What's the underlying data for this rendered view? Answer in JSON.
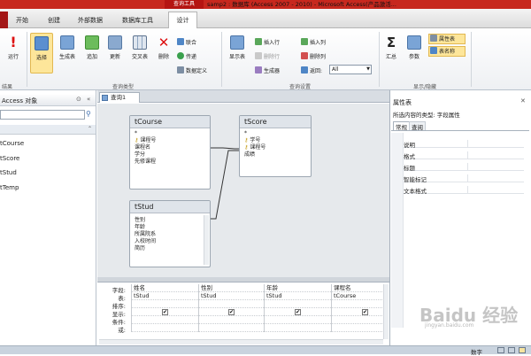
{
  "title_bar": {
    "context_tool": "查询工具",
    "window_title": "samp2 : 数据库 (Access 2007 - 2010) - Microsoft Access(产品激活..."
  },
  "tabs": [
    "开始",
    "创建",
    "外部数据",
    "数据库工具",
    "设计"
  ],
  "ribbon": {
    "run": "运行",
    "select": "选择",
    "make_table": "生成表",
    "append": "追加",
    "update": "更新",
    "crosstab": "交叉表",
    "delete": "删除",
    "union": "联合",
    "passthrough": "传递",
    "data_definition": "数据定义",
    "show_table": "显示表",
    "insert_row": "插入行",
    "delete_row": "删除行",
    "builder": "生成器",
    "insert_col": "插入列",
    "delete_col": "删除列",
    "return_label": "返回:",
    "return_value": "All",
    "totals": "汇总",
    "parameters": "参数",
    "property_sheet": "属性表",
    "table_names": "表名称",
    "group_results": "结果",
    "group_query_type": "查询类型",
    "group_query_setup": "查询设置",
    "group_show_hide": "显示/隐藏"
  },
  "nav": {
    "title": "Access 对象",
    "items": [
      "tCourse",
      "tScore",
      "tStud",
      "tTemp"
    ]
  },
  "doc_tab": "查询1",
  "tables": {
    "tCourse": {
      "name": "tCourse",
      "fields": [
        "*",
        "课程号",
        "课程名",
        "学分",
        "先修课程"
      ]
    },
    "tScore": {
      "name": "tScore",
      "fields": [
        "*",
        "学号",
        "课程号",
        "成绩"
      ]
    },
    "tStud": {
      "name": "tStud",
      "fields": [
        "性别",
        "年龄",
        "所属院系",
        "入校时间",
        "简历"
      ]
    }
  },
  "grid": {
    "row_labels": [
      "字段:",
      "表:",
      "排序:",
      "显示:",
      "条件:",
      "或:"
    ],
    "columns": [
      {
        "field": "姓名",
        "table": "tStud",
        "show": "✔"
      },
      {
        "field": "性别",
        "table": "tStud",
        "show": "✔"
      },
      {
        "field": "年龄",
        "table": "tStud",
        "show": "✔"
      },
      {
        "field": "课程名",
        "table": "tCourse",
        "show": "✔"
      }
    ]
  },
  "property_sheet": {
    "title": "属性表",
    "selection_type": "所选内容的类型: 字段属性",
    "tabs": [
      "常规",
      "查阅"
    ],
    "rows": [
      "说明",
      "格式",
      "标题",
      "智能标记",
      "文本格式"
    ]
  },
  "status": {
    "right": "数字"
  },
  "watermark": {
    "main": "Baidu 经验",
    "sub": "jingyan.baidu.com"
  },
  "colors": {
    "title_bar": "#c7281e",
    "context_tab": "#b51512",
    "ribbon": "#eef0f3"
  }
}
